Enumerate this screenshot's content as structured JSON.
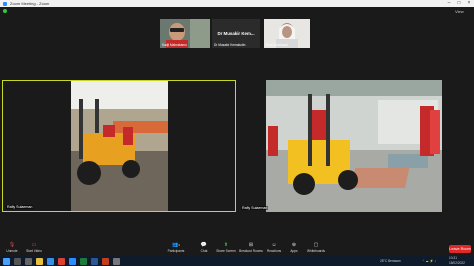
{
  "window": {
    "title": "Zoom Meeting - Zoom"
  },
  "view": {
    "label": "View"
  },
  "strip": [
    {
      "label": "Kadji Mahrakamu"
    },
    {
      "name": "Dr Musakir Kem...",
      "label": "Dr Musakir Kemaludin"
    },
    {
      "label": "Dora Novitasari"
    }
  ],
  "tiles": [
    {
      "label": "Rafly Sulaeman"
    },
    {
      "label": "Rafly Sulaeman"
    }
  ],
  "toolbar": {
    "unmute": "Unmute",
    "start_video": "Start Video",
    "participants": "Participants",
    "chat": "Chat",
    "share_screen": "Share Screen",
    "breakout": "Breakout Rooms",
    "reactions": "Reactions",
    "apps": "Apps",
    "whiteboards": "Whiteboards",
    "leave": "Leave Room",
    "participant_count": "4"
  },
  "taskbar": {
    "weather": "28°C Berawan",
    "time": "10:31",
    "date": "18/02/2022"
  }
}
